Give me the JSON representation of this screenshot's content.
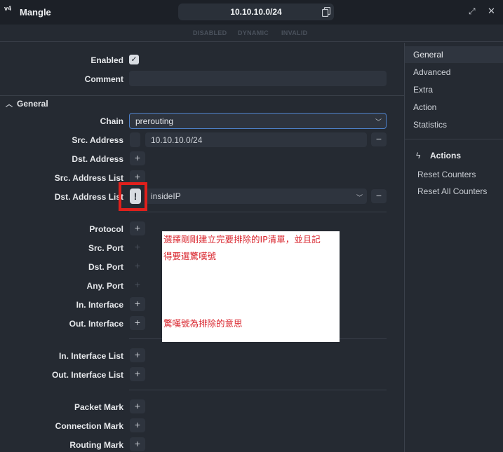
{
  "window": {
    "title": "Mangle",
    "icon": "ipv4-icon",
    "icon_text": "v4",
    "address": "10.10.10.0/24"
  },
  "flags": [
    "DISABLED",
    "DYNAMIC",
    "INVALID"
  ],
  "form": {
    "enabled_label": "Enabled",
    "enabled_checked": true,
    "comment_label": "Comment",
    "comment_value": "",
    "section_general": "General",
    "chain_label": "Chain",
    "chain_value": "prerouting",
    "src_address_label": "Src. Address",
    "src_address_value": "10.10.10.0/24",
    "dst_address_label": "Dst. Address",
    "src_address_list_label": "Src. Address List",
    "dst_address_list_label": "Dst. Address List",
    "dst_address_list_negate": "!",
    "dst_address_list_value": "insideIP",
    "protocol_label": "Protocol",
    "src_port_label": "Src. Port",
    "dst_port_label": "Dst. Port",
    "any_port_label": "Any. Port",
    "in_interface_label": "In. Interface",
    "out_interface_label": "Out. Interface",
    "in_interface_list_label": "In. Interface List",
    "out_interface_list_label": "Out. Interface List",
    "packet_mark_label": "Packet Mark",
    "connection_mark_label": "Connection Mark",
    "routing_mark_label": "Routing Mark"
  },
  "sidebar": {
    "tabs": [
      "General",
      "Advanced",
      "Extra",
      "Action",
      "Statistics"
    ],
    "active_tab": "General",
    "actions_title": "Actions",
    "actions": [
      "Reset Counters",
      "Reset All Counters"
    ]
  },
  "annotation": {
    "line1": "選擇剛剛建立完要排除的IP清單，並且記",
    "line2": "得要選驚嘆號",
    "line3": "驚嘆號為排除的意思",
    "color": "#d9262e",
    "highlight_color": "#e0201c"
  },
  "colors": {
    "background": "#252a32",
    "titlebar": "#1c2027",
    "field": "#2e343e",
    "focus_border": "#4d7fc7"
  }
}
